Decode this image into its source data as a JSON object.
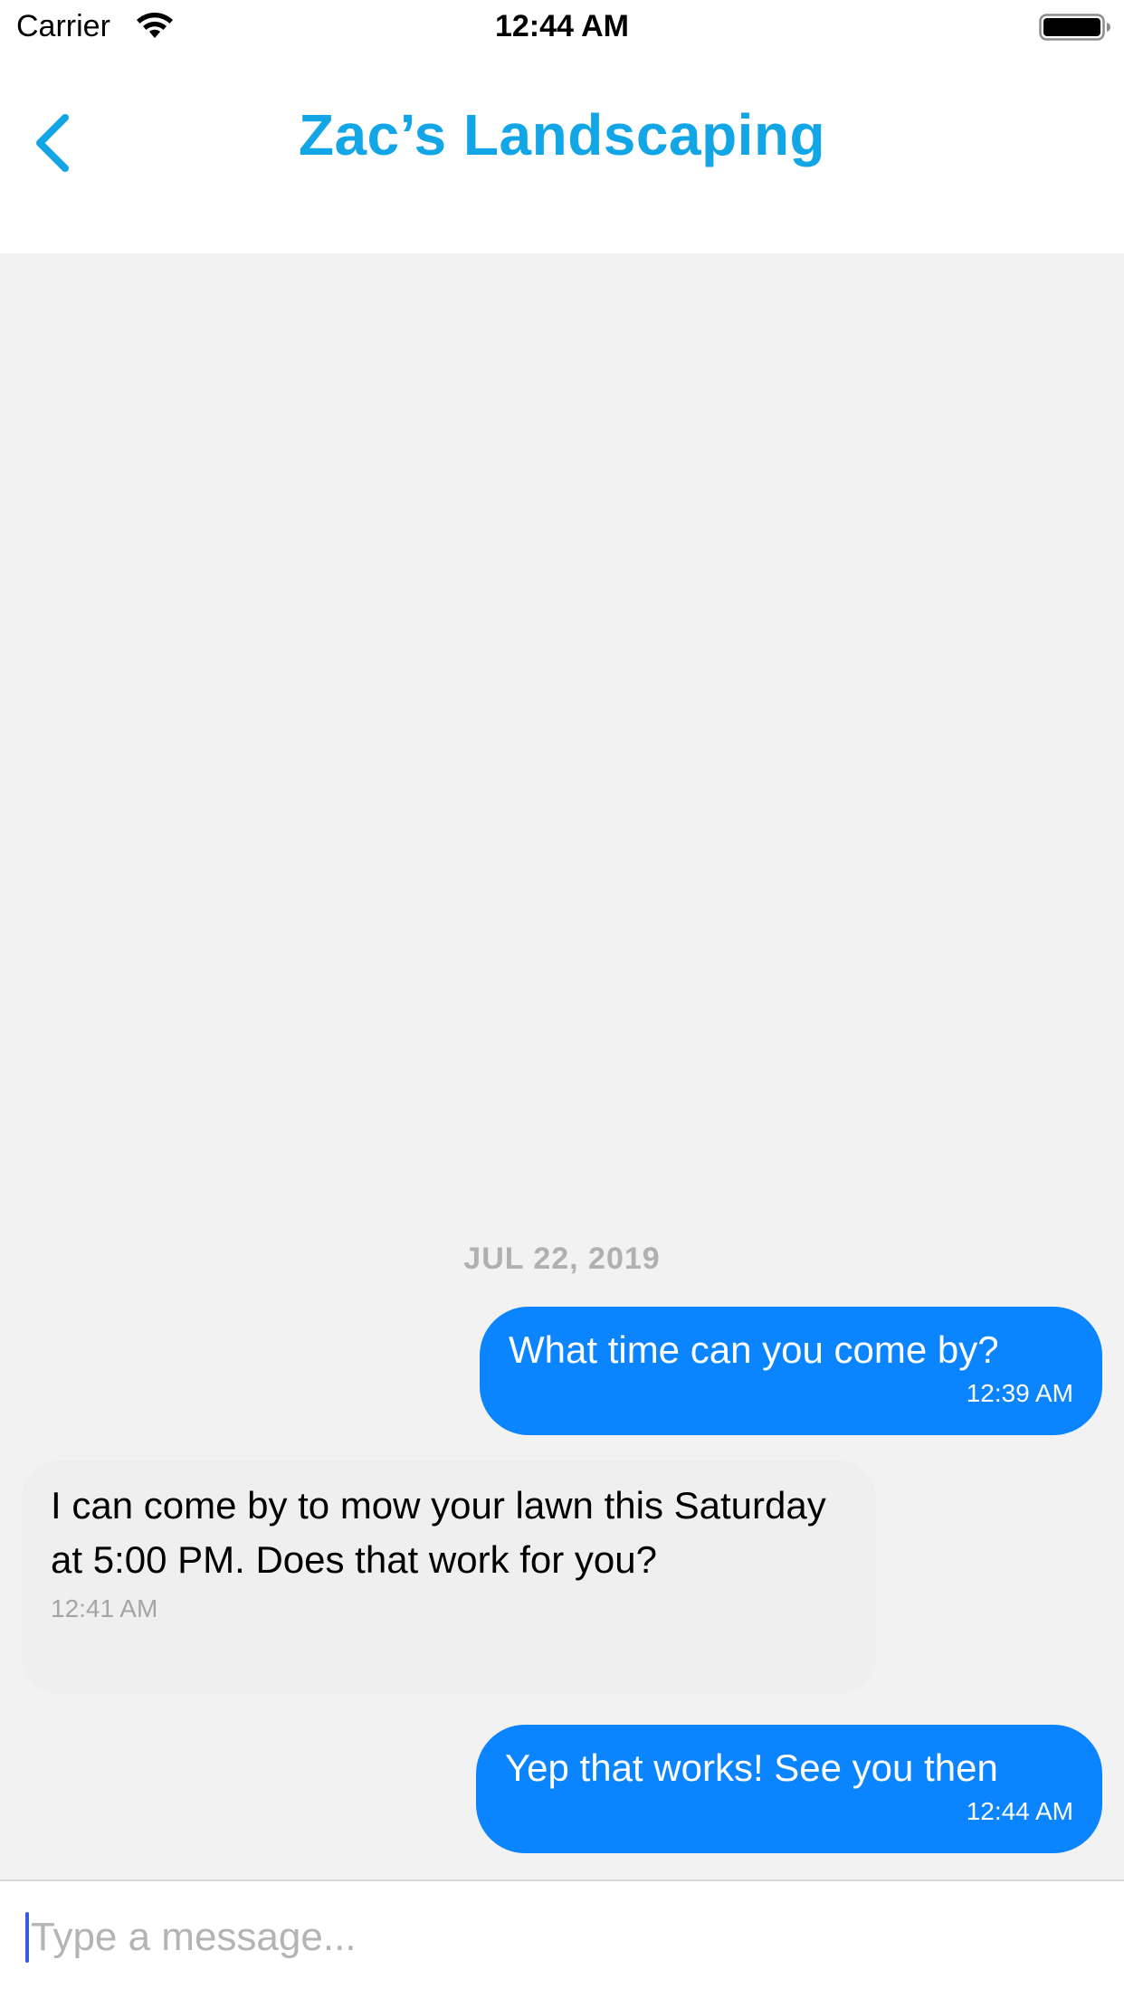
{
  "status_bar": {
    "carrier": "Carrier",
    "time": "12:44 AM",
    "wifi_icon": "wifi-icon",
    "battery_icon": "battery-full-icon"
  },
  "header": {
    "back_icon": "chevron-left-icon",
    "title": "Zac’s Landscaping"
  },
  "chat": {
    "date_label": "JUL 22, 2019",
    "messages": [
      {
        "direction": "outgoing",
        "text": "What time can you come by?",
        "time": "12:39 AM"
      },
      {
        "direction": "incoming",
        "text": "I can come by to mow your lawn this Saturday at 5:00 PM. Does that work for you?",
        "time": "12:41 AM"
      },
      {
        "direction": "outgoing",
        "text": "Yep that works! See you then",
        "time": "12:44 AM"
      }
    ]
  },
  "composer": {
    "placeholder": "Type a message...",
    "value": ""
  },
  "colors": {
    "accent": "#13A6E6",
    "outgoing_bubble": "#0A84FF",
    "incoming_bubble": "#EFEFEF",
    "chat_background": "#F2F2F2"
  }
}
